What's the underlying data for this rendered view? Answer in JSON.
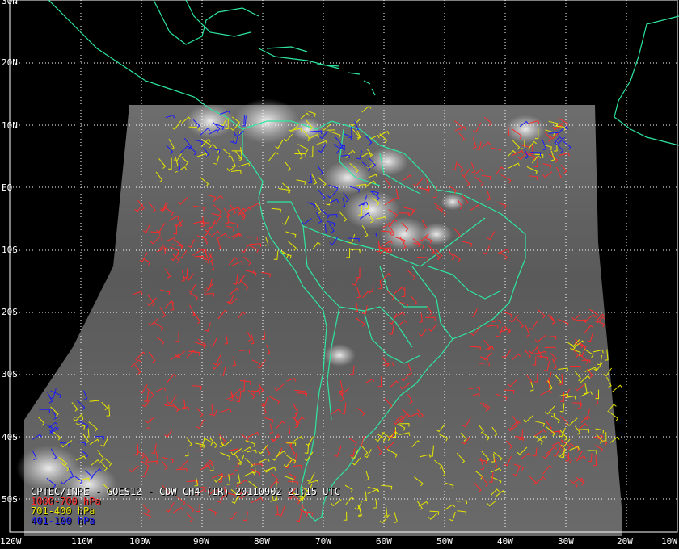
{
  "title": "CPTEC/INPE - GOES12 - CDW CH4 (IR) 20110902 21:15 UTC",
  "latitude_labels": [
    "30N",
    "20N",
    "10N",
    "EQ",
    "10S",
    "20S",
    "30S",
    "40S",
    "50S"
  ],
  "longitude_labels": [
    "120W",
    "110W",
    "100W",
    "90W",
    "80W",
    "70W",
    "60W",
    "50W",
    "40W",
    "30W",
    "20W",
    "10W"
  ],
  "legend": [
    {
      "label": "1000-700 hPa",
      "color": "#ff2a2a"
    },
    {
      "label": "701-400 hPa",
      "color": "#e6e600"
    },
    {
      "label": "401-100 hPa",
      "color": "#1a1aff"
    }
  ],
  "colors": {
    "background": "#000000",
    "coastline": "#2ee6a0",
    "grid": "#ffffff",
    "label": "#ffffff"
  },
  "map": {
    "projection": "cylindrical",
    "lon_range": [
      -120,
      -10
    ],
    "lat_range": [
      -55,
      30
    ],
    "grid_spacing_deg": 10,
    "grid_style": "dotted"
  }
}
